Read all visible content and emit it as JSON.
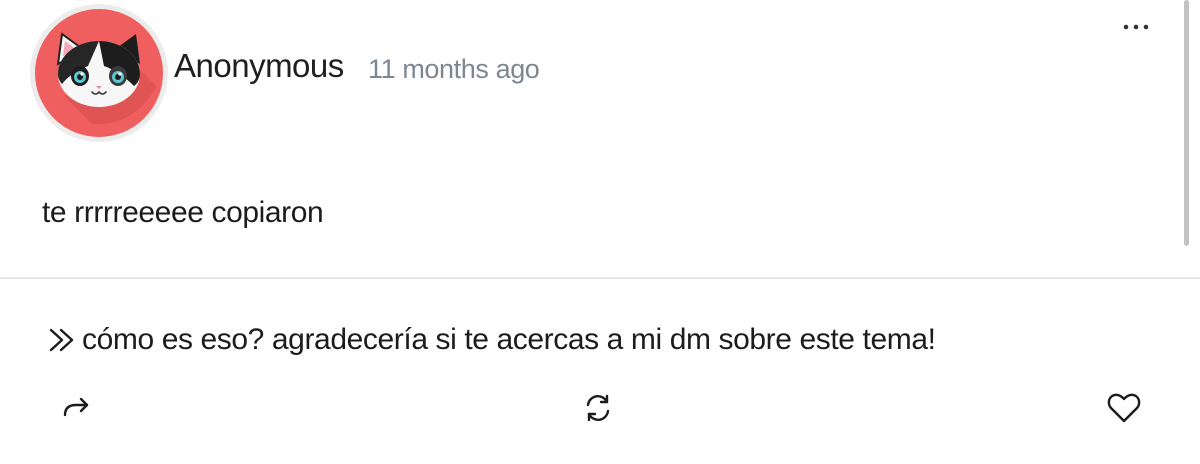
{
  "post": {
    "author": "Anonymous",
    "timestamp": "11 months ago",
    "question": "te rrrrreeeee copiaron",
    "more_icon": "more-horizontal-icon",
    "avatar_icon": "cat-avatar-icon"
  },
  "answer": {
    "text": "cómo es eso? agradecería si te acercas a mi dm sobre este tema!",
    "prefix_icon": "double-chevron-right-icon"
  },
  "actions": [
    {
      "icon": "share-icon"
    },
    {
      "icon": "refresh-icon"
    },
    {
      "icon": "heart-icon"
    }
  ],
  "colors": {
    "avatar_bg": "#ef5f5f",
    "timestamp": "#7c8792",
    "divider": "#e6e6e6"
  }
}
